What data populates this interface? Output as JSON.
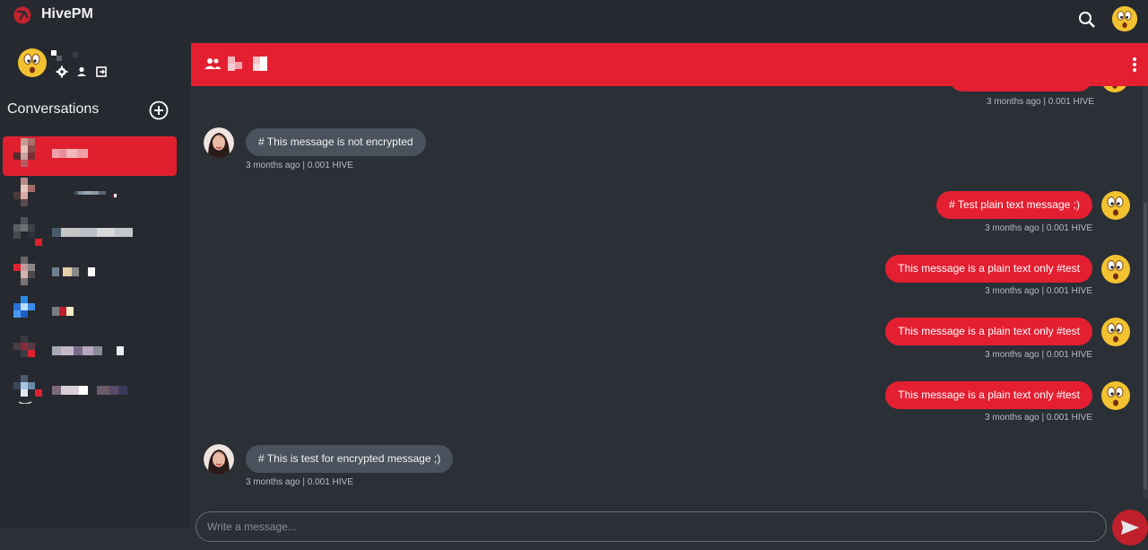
{
  "app": {
    "title": "HivePM",
    "logo_icon": "hive-logo-icon",
    "brand_color": "#e41f31"
  },
  "topbar": {
    "search_icon": "search-icon",
    "avatar_icon": "emoji-avatar-icon"
  },
  "sidebar": {
    "profile": {
      "settings_icon": "gear-icon",
      "profile_icon": "person-icon",
      "logout_icon": "logout-icon"
    },
    "conversations_title": "Conversations",
    "add_icon": "add-circle-icon",
    "items_count_visible": 7
  },
  "chat": {
    "header_icon": "group-icon",
    "menu_icon": "more-vertical-icon",
    "top_meta": "3 months ago | 0.001 HIVE",
    "messages": [
      {
        "dir": "in",
        "text": "# This message is not encrypted",
        "meta": "3 months ago | 0.001 HIVE"
      },
      {
        "dir": "out",
        "text": "# Test plain text message ;)",
        "meta": "3 months ago | 0.001 HIVE"
      },
      {
        "dir": "out",
        "text": "This message is a plain text only #test",
        "meta": "3 months ago | 0.001 HIVE"
      },
      {
        "dir": "out",
        "text": "This message is a plain text only #test",
        "meta": "3 months ago | 0.001 HIVE"
      },
      {
        "dir": "out",
        "text": "This message is a plain text only #test",
        "meta": "3 months ago | 0.001 HIVE"
      },
      {
        "dir": "in",
        "text": "# This is test for encrypted message ;)",
        "meta": "3 months ago | 0.001 HIVE"
      }
    ],
    "input_placeholder": "Write a message...",
    "send_icon": "send-icon"
  }
}
